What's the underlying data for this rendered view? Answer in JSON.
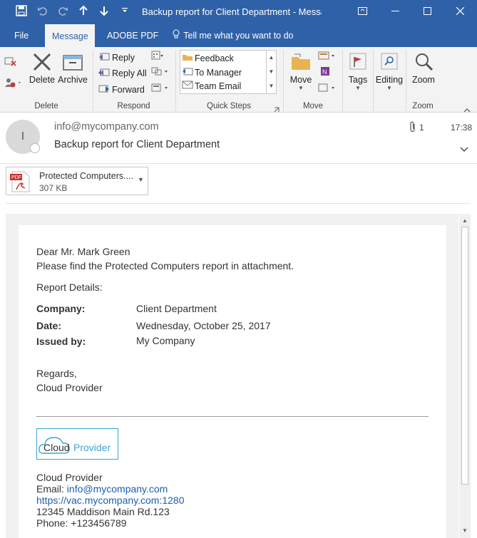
{
  "window": {
    "title": "Backup report for Client Department  -  Messa",
    "qat": [
      "save-icon",
      "undo-icon",
      "redo-icon",
      "up-icon",
      "down-icon",
      "customize-icon"
    ]
  },
  "tabs": {
    "file": "File",
    "message": "Message",
    "adobe": "ADOBE PDF",
    "tell": "Tell me what you want to do"
  },
  "ribbon": {
    "delete": {
      "delete_label": "Delete",
      "archive_label": "Archive",
      "group": "Delete"
    },
    "respond": {
      "reply": "Reply",
      "reply_all": "Reply All",
      "forward": "Forward",
      "group": "Respond"
    },
    "quick_steps": {
      "items": [
        "Feedback",
        "To Manager",
        "Team Email"
      ],
      "group": "Quick Steps"
    },
    "move": {
      "move_label": "Move",
      "group": "Move"
    },
    "tags": {
      "label": "Tags"
    },
    "editing": {
      "label": "Editing"
    },
    "zoom": {
      "label": "Zoom",
      "group": "Zoom"
    }
  },
  "message": {
    "avatar_initial": "I",
    "from": "info@mycompany.com",
    "subject": "Backup report for Client Department",
    "attachment_count": "1",
    "time": "17:38"
  },
  "attachment": {
    "name": "Protected Computers....",
    "size": "307 KB",
    "badge": "PDF"
  },
  "body": {
    "greeting": "Dear Mr. Mark Green",
    "intro": "Please find the Protected Computers report in attachment.",
    "details_heading": "Report Details:",
    "details": [
      {
        "label": "Company:",
        "value": "Client Department"
      },
      {
        "label": "Date:",
        "value": "Wednesday, October 25, 2017"
      },
      {
        "label": "Issued by:",
        "value": "My Company"
      }
    ],
    "regards": "Regards,",
    "sender": "Cloud Provider",
    "logo": {
      "part1": "Cloud",
      "part2": "Provider"
    },
    "signature": {
      "company": "Cloud Provider",
      "email_label": "Email: ",
      "email": "info@mycompany.com",
      "url": "https://vac.mycompany.com:1280",
      "address": "12345 Maddison Main Rd.123",
      "phone": "Phone: +123456789"
    }
  },
  "colors": {
    "titlebar": "#2f61a8",
    "link": "#1a5fb4",
    "logo_blue": "#3aa6d4"
  }
}
